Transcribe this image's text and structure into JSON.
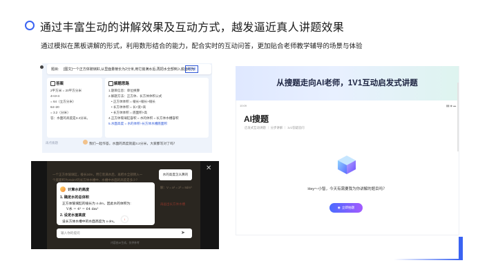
{
  "header": {
    "title": "通过丰富生动的讲解效果及互动方式，越发逼近真人讲题效果",
    "subtitle": "通过模拟在黑板讲解的形式，利用数形结合的能力，配合实时的互动问答，更加贴合老师教学辅导的场景与体验"
  },
  "panel1": {
    "question_label": "题目:",
    "question_text": "[图文]一个正方体玻璃缸,从里面量棱长为2分米,用它装满水后,再把水全部倒入底面积为",
    "question_highlight": "4分米",
    "answer_heading": "答案",
    "answer_lines": [
      "2平方米 = 20平方分米",
      "4×4×4",
      "= 64（立方分米）",
      "64÷20",
      "= 3.2（分米）",
      "答：水面的高度是3.2分米。"
    ],
    "analysis_heading": "解题思路",
    "analysis_lines": [
      "1.题目信息：单位换算",
      "2.解题方法：正方体、长方体体积公式",
      "• 正方体体积 = 棱长×棱长×棱长",
      "• 长方体体积 = 长×宽×高",
      "• 长方体体积 = 底面积×高",
      "4.正方体玻璃缸容积 = 水的体积 = 长方体水槽容积",
      "5.水面高度 = 水的体积÷长方体水槽底面积"
    ],
    "footer_hint": "再点拨题",
    "bubble": "我们一起作答。水面的高度就是3.2分米，大家都写对了吗？"
  },
  "panel2": {
    "banner_title": "从搜题走向AI老师，1V1互动启发式讲题",
    "status_time": "10:09",
    "status_icons": "▮▮ ◉ ▬",
    "app_title": "AI搜题",
    "app_subtitle": "启发式互动讲题 ｜ 分步讲解 ｜ 1v1答疑追问",
    "greeting": "Hey～小智，今天有需要我为你讲解的题目吗？",
    "button_label": "立即拍题"
  },
  "panel3": {
    "board_lines": [
      "一个正方体玻璃缸，棱长2dm，用它装满水后，再把水全部倒入一",
      "个底面积为20dm²的长方体水槽中，水槽中水面的高度是多少？",
      "解：V = a³ = 2³ = 8dm³"
    ],
    "board_red": "再画出长方体水槽",
    "tip": "水的高度怎么算的",
    "card_title": "计算水的高度",
    "step1": "1. 确定水的总体积",
    "step1_desc": "正方体玻璃缸的棱长为 4 dm，因此水的体积为:",
    "formula": "V水 = 4³ = 64 dm³",
    "step2": "2. 设定水面高度",
    "step2_desc": "设长方体水槽中的水面高度为 x dm。",
    "input_placeholder": "输入你的提问",
    "footer": "内容由AI生成，仅供参考",
    "close_glyph": "✕",
    "send_glyph": "➤",
    "down_glyph": "↓"
  },
  "colors": {
    "accent": "#3a63f2",
    "button_gradient_start": "#4b6bff",
    "button_gradient_end": "#a35bff"
  }
}
